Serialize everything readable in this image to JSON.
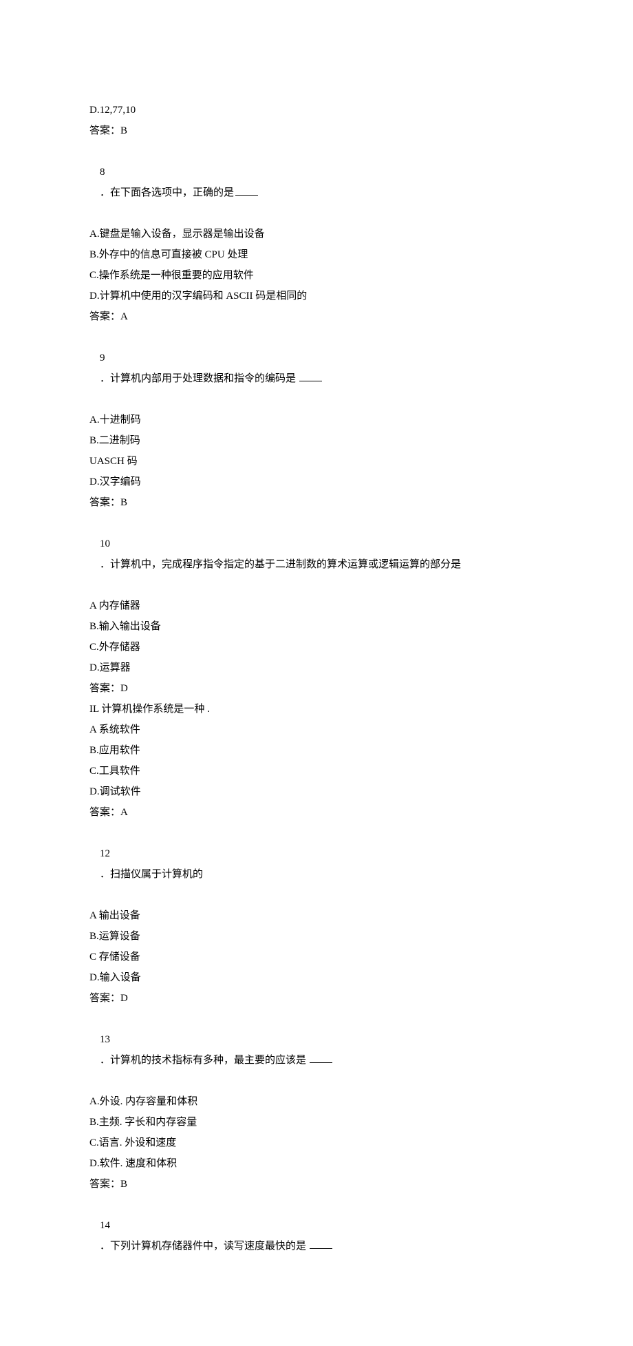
{
  "lines": {
    "l1": "D.12,77,10",
    "l2": "答案：B",
    "l3a": "8",
    "l3b": "．在下面各选项中，正确的是",
    "l4": "A.键盘是输入设备，显示器是输出设备",
    "l5": "B.外存中的信息可直接被 CPU 处理",
    "l6": "C.操作系统是一种很重要的应用软件",
    "l7": "D.计算机中使用的汉字编码和 ASCII 码是相同的",
    "l8": "答案：A",
    "l9a": "9",
    "l9b": "．计算机内部用于处理数据和指令的编码是 ",
    "l10": "A.十进制码",
    "l11": "B.二进制码",
    "l12": "UASCH 码",
    "l13": "D.汉字编码",
    "l14": "答案：B",
    "l15a": "10",
    "l15b": "．计算机中，完成程序指令指定的基于二进制数的算术运算或逻辑运算的部分是",
    "l16": "A 内存储器",
    "l17": "B.输入输出设备",
    "l18": "C.外存储器",
    "l19": "D.运算器",
    "l20": "答案：D",
    "l21": "IL 计算机操作系统是一种 .",
    "l22": "A 系统软件",
    "l23": "B.应用软件",
    "l24": "C.工具软件",
    "l25": "D.调试软件",
    "l26": "答案：A",
    "l27a": "12",
    "l27b": "．扫描仪属于计算机的",
    "l28": "A 输出设备",
    "l29": "B.运算设备",
    "l30": "C 存储设备",
    "l31": "D.输入设备",
    "l32": "答案：D",
    "l33a": "13",
    "l33b": "．计算机的技术指标有多种，最主要的应该是 ",
    "l34": "A.外设. 内存容量和体积",
    "l35": "B.主频. 字长和内存容量",
    "l36": "C.语言. 外设和速度",
    "l37": "D.软件. 速度和体积",
    "l38": "答案：B",
    "l39a": "14",
    "l39b": "．下列计算机存储器件中，读写速度最快的是 "
  }
}
